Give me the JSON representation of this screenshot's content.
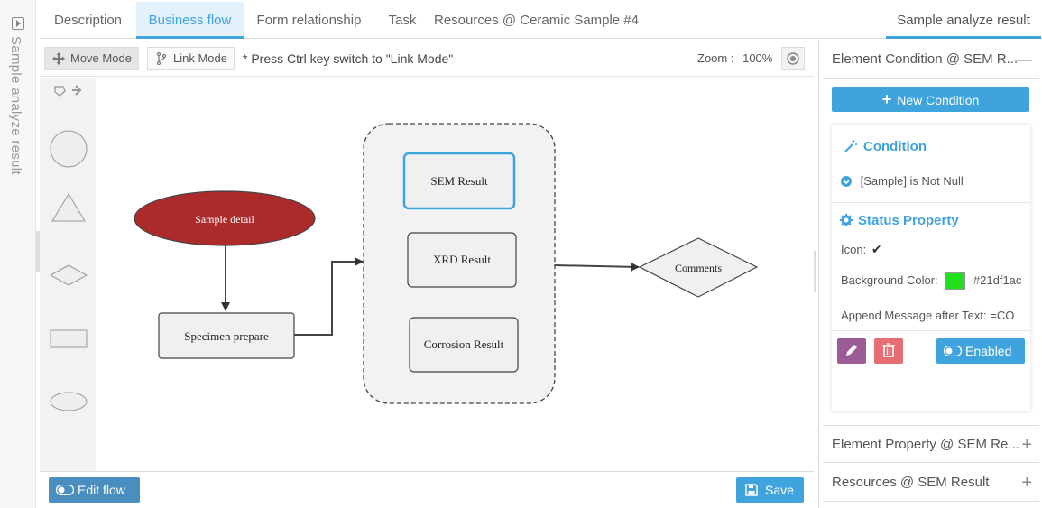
{
  "side": {
    "title": "Sample analyze result"
  },
  "tabs": [
    {
      "label": "Description"
    },
    {
      "label": "Business flow"
    },
    {
      "label": "Form relationship"
    },
    {
      "label": "Task"
    },
    {
      "label": "Resources @ Ceramic Sample #4"
    },
    {
      "label": "Sample analyze result"
    }
  ],
  "toolbar": {
    "move_mode": "Move Mode",
    "link_mode": "Link Mode",
    "note": "* Press Ctrl key switch to \"Link Mode\"",
    "zoom_label": "Zoom :",
    "zoom_value": "100%"
  },
  "flow": {
    "nodes": {
      "sample_detail": "Sample detail",
      "specimen_prepare": "Specimen prepare",
      "sem_result": "SEM Result",
      "xrd_result": "XRD Result",
      "corrosion_result": "Corrosion Result",
      "comments": "Comments"
    },
    "colors": {
      "sample_detail_fill": "#ad2a2a",
      "selected_border": "#3fa4de"
    }
  },
  "bottom": {
    "edit_flow": "Edit flow",
    "save": "Save"
  },
  "panel": {
    "element_condition": "Element Condition @ SEM R...",
    "new_condition": "New Condition",
    "condition_title": "Condition",
    "condition_item": "[Sample] is Not Null",
    "status_title": "Status Property",
    "icon_label": "Icon:",
    "bg_label": "Background Color:",
    "bg_value": "#21df1ac",
    "append_label": "Append Message after Text: =CO",
    "enabled": "Enabled",
    "element_property": "Element Property @ SEM Re...",
    "resources": "Resources @ SEM Result"
  },
  "colors": {
    "accent": "#3fa4de",
    "swatch": "#21df1a",
    "edit": "#9b5c96",
    "delete": "#e76c74"
  }
}
